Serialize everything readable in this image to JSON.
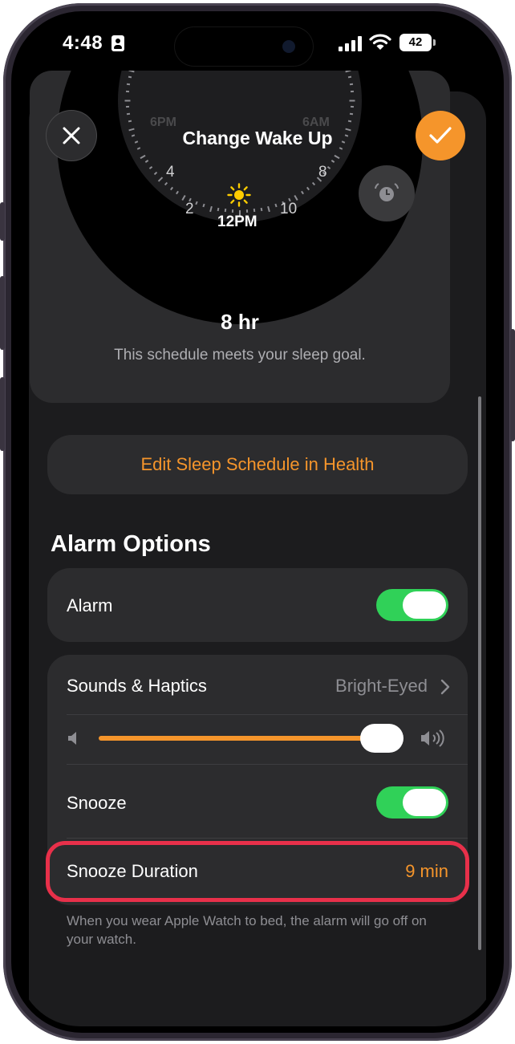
{
  "status_bar": {
    "time": "4:48",
    "battery": "42"
  },
  "sheet": {
    "title": "Change Wake Up",
    "close_icon": "close-icon",
    "confirm_icon": "checkmark-icon"
  },
  "schedule_card": {
    "dial_labels": {
      "l4": "4",
      "l8": "8",
      "l2": "2",
      "l10": "10",
      "noon": "12PM",
      "top_left": "6PM",
      "top_right": "6AM"
    },
    "sun_icon": "sun-icon",
    "alarm_icon": "alarm-clock-icon",
    "duration": "8 hr",
    "goal_text": "This schedule meets your sleep goal."
  },
  "edit_button": {
    "label": "Edit Sleep Schedule in Health"
  },
  "alarm_options": {
    "title": "Alarm Options",
    "alarm": {
      "label": "Alarm",
      "on": true
    },
    "sounds": {
      "label": "Sounds & Haptics",
      "value": "Bright-Eyed"
    },
    "volume": {
      "level": 0.93
    },
    "snooze": {
      "label": "Snooze",
      "on": true
    },
    "snooze_duration": {
      "label": "Snooze Duration",
      "value": "9 min"
    },
    "footer": "When you wear Apple Watch to bed, the alarm will go off on your watch."
  },
  "colors": {
    "accent": "#f5952b",
    "toggle_on": "#30d158",
    "highlight": "#e8304a"
  }
}
